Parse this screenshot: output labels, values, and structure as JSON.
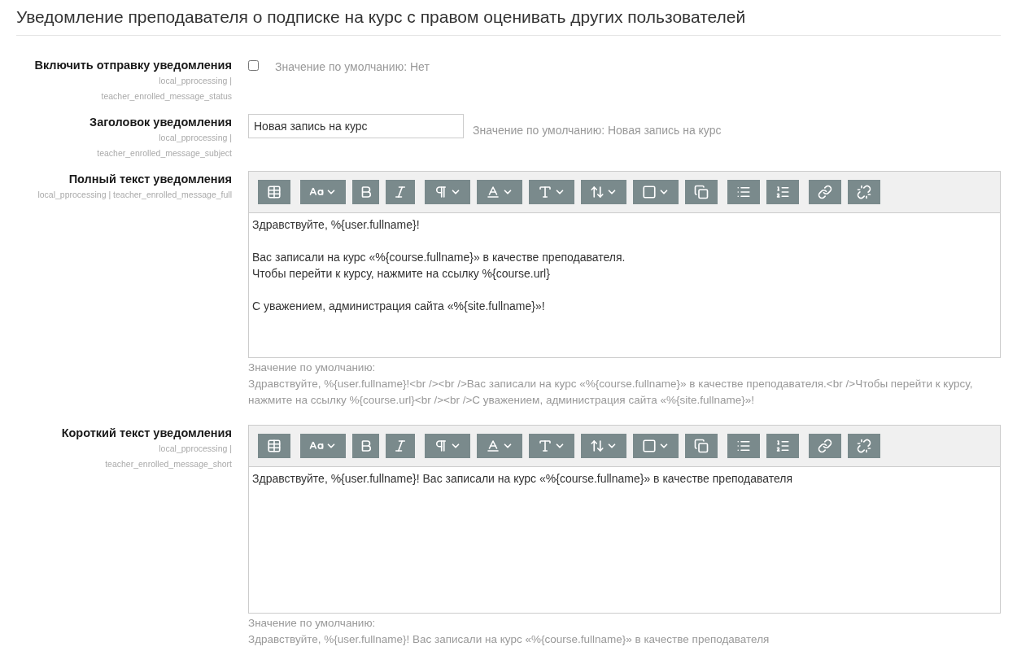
{
  "heading": "Уведомление преподавателя о подписке на курс с правом оценивать других пользователей",
  "settings": [
    {
      "kind": "checkbox",
      "label": "Включить отправку уведомления",
      "plugin": "local_pprocessing",
      "separator": "|",
      "setting": "teacher_enrolled_message_status",
      "checked": false,
      "default": "Значение по умолчанию: Нет"
    },
    {
      "kind": "text",
      "label": "Заголовок уведомления",
      "plugin": "local_pprocessing",
      "separator": "|",
      "setting": "teacher_enrolled_message_subject",
      "value": "Новая запись на курс",
      "default": "Значение по умолчанию: Новая запись на курс"
    },
    {
      "kind": "editor",
      "label": "Полный текст уведомления",
      "plugin": "local_pprocessing",
      "separator": "|",
      "setting": "teacher_enrolled_message_full",
      "value": [
        [
          "Здравствуйте, %{user.fullname}!"
        ],
        [
          "Вас записали на курс «%{course.fullname}» в качестве преподавателя.",
          "Чтобы перейти к курсу, нажмите на ссылку %{course.url}"
        ],
        [
          "С уважением, администрация сайта «%{site.fullname}»!"
        ]
      ],
      "default_label": "Значение по умолчанию:",
      "default": "Здравствуйте, %{user.fullname}!<br /><br />Вас записали на курс «%{course.fullname}» в качестве преподавателя.<br />Чтобы перейти к курсу, нажмите на ссылку %{course.url}<br /><br />С уважением, администрация сайта «%{site.fullname}»!"
    },
    {
      "kind": "editor",
      "label": "Короткий текст уведомления",
      "plugin": "local_pprocessing",
      "separator": "|",
      "setting": "teacher_enrolled_message_short",
      "value": [
        [
          "Здравствуйте, %{user.fullname}! Вас записали на курс «%{course.fullname}» в качестве преподавателя"
        ]
      ],
      "default_label": "Значение по умолчанию:",
      "default": "Здравствуйте, %{user.fullname}! Вас записали на курс «%{course.fullname}» в качестве преподавателя"
    }
  ]
}
